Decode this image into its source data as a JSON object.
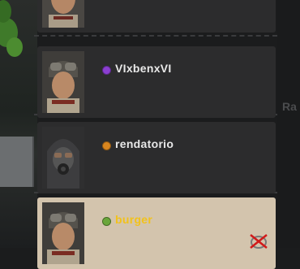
{
  "players": [
    {
      "name": "",
      "status_color": "#8a8a8a"
    },
    {
      "name": "VIxbenxVI",
      "status_color": "#8b3fd1"
    },
    {
      "name": "rendatorio",
      "status_color": "#d9861f"
    },
    {
      "name": "burger",
      "status_color": "#6aa63a"
    }
  ],
  "side_label": "Ra",
  "colors": {
    "row_bg": "#2c2c2d",
    "selected_row_bg": "#d3c4ad",
    "selected_name": "#f2c21b"
  },
  "icons": {
    "status": "dot-icon",
    "remove": "remove-player-icon",
    "avatar_goggles": "goggles-avatar",
    "avatar_gasmask": "gasmask-avatar"
  }
}
